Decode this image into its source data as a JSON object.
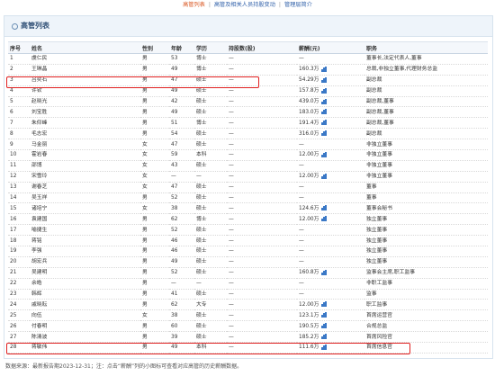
{
  "nav": {
    "links": [
      "高管列表",
      "高管及相关人员持股变动",
      "管理层简介"
    ],
    "separator": "|",
    "active_color": "#d9541e",
    "link_color": "#2d5ea8"
  },
  "panel": {
    "title": "高管列表",
    "highlight_color": "#e02020"
  },
  "table": {
    "headers": [
      "序号",
      "姓名",
      "性别",
      "年龄",
      "学历",
      "持股数(股)",
      "薪酬(元)",
      "职务"
    ],
    "rows": [
      [
        "1",
        "虞仁民",
        "男",
        "53",
        "博士",
        "—",
        "—",
        "董事长,法定代表人,董事"
      ],
      [
        "2",
        "王琳晶",
        "男",
        "49",
        "博士",
        "—",
        "160.3万",
        "总裁,非独立董事,代理财务总监"
      ],
      [
        "3",
        "吕奕石",
        "男",
        "47",
        "硕士",
        "—",
        "54.29万",
        "副总裁"
      ],
      [
        "4",
        "许钦",
        "男",
        "49",
        "硕士",
        "—",
        "157.8万",
        "副总裁"
      ],
      [
        "5",
        "赵晓光",
        "男",
        "42",
        "硕士",
        "—",
        "439.0万",
        "副总裁,董事"
      ],
      [
        "6",
        "刘宝胜",
        "男",
        "49",
        "硕士",
        "—",
        "183.0万",
        "副总裁,董事"
      ],
      [
        "7",
        "朱仰峰",
        "男",
        "51",
        "博士",
        "—",
        "191.4万",
        "副总裁,董事"
      ],
      [
        "8",
        "毛志宏",
        "男",
        "54",
        "硕士",
        "—",
        "316.0万",
        "副总裁"
      ],
      [
        "9",
        "马金丽",
        "女",
        "47",
        "硕士",
        "—",
        "—",
        "非独立董事"
      ],
      [
        "10",
        "霍岩春",
        "女",
        "59",
        "本科",
        "—",
        "12.00万",
        "非独立董事"
      ],
      [
        "11",
        "邵博",
        "女",
        "43",
        "硕士",
        "—",
        "—",
        "非独立董事"
      ],
      [
        "12",
        "宋雪玲",
        "女",
        "—",
        "—",
        "—",
        "12.00万",
        "非独立董事"
      ],
      [
        "13",
        "谢春芝",
        "女",
        "47",
        "硕士",
        "—",
        "—",
        "董事"
      ],
      [
        "14",
        "吴玉祥",
        "男",
        "52",
        "硕士",
        "—",
        "—",
        "董事"
      ],
      [
        "15",
        "诸培宁",
        "女",
        "38",
        "硕士",
        "—",
        "124.6万",
        "董事会秘书"
      ],
      [
        "16",
        "袁建国",
        "男",
        "62",
        "博士",
        "—",
        "12.00万",
        "独立董事"
      ],
      [
        "17",
        "喻捷生",
        "男",
        "52",
        "硕士",
        "—",
        "—",
        "独立董事"
      ],
      [
        "18",
        "蒋铭",
        "男",
        "46",
        "硕士",
        "—",
        "—",
        "独立董事"
      ],
      [
        "19",
        "李强",
        "男",
        "46",
        "硕士",
        "—",
        "—",
        "独立董事"
      ],
      [
        "20",
        "胡宏兵",
        "男",
        "49",
        "硕士",
        "—",
        "—",
        "独立董事"
      ],
      [
        "21",
        "吴建明",
        "男",
        "52",
        "硕士",
        "—",
        "160.8万",
        "监事会主席,职工监事"
      ],
      [
        "22",
        "余皓",
        "男",
        "—",
        "—",
        "—",
        "—",
        "非职工监事"
      ],
      [
        "23",
        "韩辉",
        "男",
        "41",
        "硕士",
        "—",
        "—",
        "监事"
      ],
      [
        "24",
        "戚晓耘",
        "男",
        "62",
        "大专",
        "—",
        "12.00万",
        "职工监事"
      ],
      [
        "25",
        "向伍",
        "女",
        "38",
        "硕士",
        "—",
        "123.1万",
        "首席运营官"
      ],
      [
        "26",
        "付春明",
        "男",
        "60",
        "硕士",
        "—",
        "190.5万",
        "合规总监"
      ],
      [
        "27",
        "陈清波",
        "男",
        "39",
        "硕士",
        "—",
        "185.2万",
        "首席风险官"
      ],
      [
        "28",
        "蒋敏伟",
        "男",
        "49",
        "本科",
        "—",
        "111.6万",
        "首席信息官"
      ]
    ]
  },
  "footnote": "数据来源：最新报告期2023-12-31；注：点击“薪酬”列的小图标可查看对应高管的历史薪酬数据。"
}
